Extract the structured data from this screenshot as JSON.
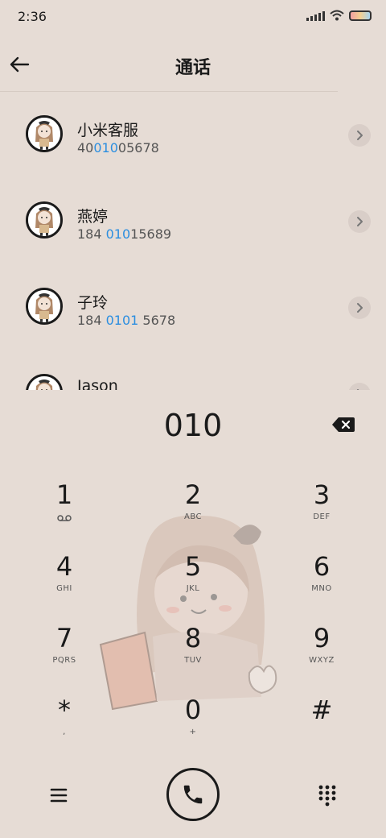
{
  "status": {
    "time": "2:36"
  },
  "header": {
    "title": "通话",
    "back_icon": "arrow-left-icon"
  },
  "contacts": [
    {
      "name": "小米客服",
      "number_before": "40",
      "number_match": "010",
      "number_after": "05678"
    },
    {
      "name": "燕婷",
      "number_before": "184 ",
      "number_match": "010",
      "number_after": "15689"
    },
    {
      "name": "子玲",
      "number_before": "184 ",
      "number_match": "0101",
      "number_after": " 5678"
    },
    {
      "name": "Jason",
      "number_before": "",
      "number_match": "",
      "number_after": ""
    }
  ],
  "dial": {
    "input": "010"
  },
  "keypad": [
    {
      "digit": "1",
      "letters": ""
    },
    {
      "digit": "2",
      "letters": "ABC"
    },
    {
      "digit": "3",
      "letters": "DEF"
    },
    {
      "digit": "4",
      "letters": "GHI"
    },
    {
      "digit": "5",
      "letters": "JKL"
    },
    {
      "digit": "6",
      "letters": "MNO"
    },
    {
      "digit": "7",
      "letters": "PQRS"
    },
    {
      "digit": "8",
      "letters": "TUV"
    },
    {
      "digit": "9",
      "letters": "WXYZ"
    },
    {
      "digit": "*",
      "letters": ","
    },
    {
      "digit": "0",
      "letters": "+"
    },
    {
      "digit": "#",
      "letters": ""
    }
  ],
  "colors": {
    "background": "#e6dcd5",
    "highlight": "#2b8ee0"
  }
}
